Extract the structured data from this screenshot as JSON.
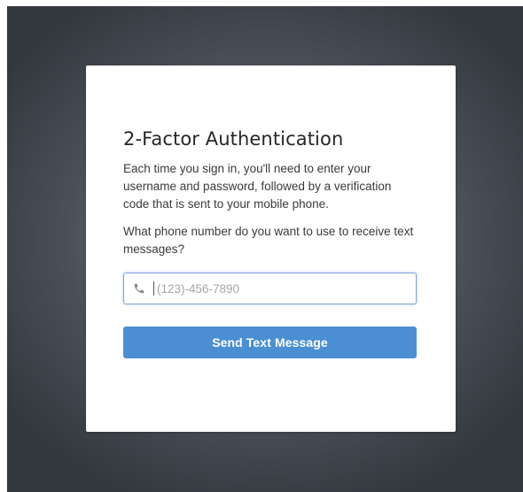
{
  "dialog": {
    "title": "2-Factor Authentication",
    "description": "Each time you sign in, you'll need to enter your username and password, followed by a verification code that is sent to your mobile phone.",
    "question": "What phone number do you want to use to receive text messages?",
    "phone_field": {
      "icon": "phone-icon",
      "value": "",
      "placeholder": "(123)-456-7890"
    },
    "send_button_label": "Send Text Message"
  },
  "colors": {
    "accent": "#4b8fd2",
    "focus_border": "#7ea7d6",
    "backdrop": "#4b4f57"
  }
}
